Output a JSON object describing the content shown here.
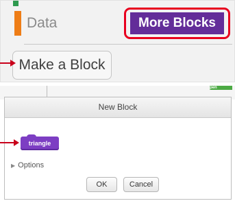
{
  "palette": {
    "data_label": "Data",
    "more_blocks_label": "More Blocks",
    "make_block_label": "Make a Block",
    "colors": {
      "data_category": "#ee7d16",
      "more_blocks_category": "#632d99",
      "highlight": "#e8001e"
    }
  },
  "dialog": {
    "title": "New Block",
    "block_label": "triangle",
    "options_label": "Options",
    "ok_label": "OK",
    "cancel_label": "Cancel",
    "background_block_label": "pen"
  },
  "annotations": {
    "arrow_color": "#e8001e"
  }
}
